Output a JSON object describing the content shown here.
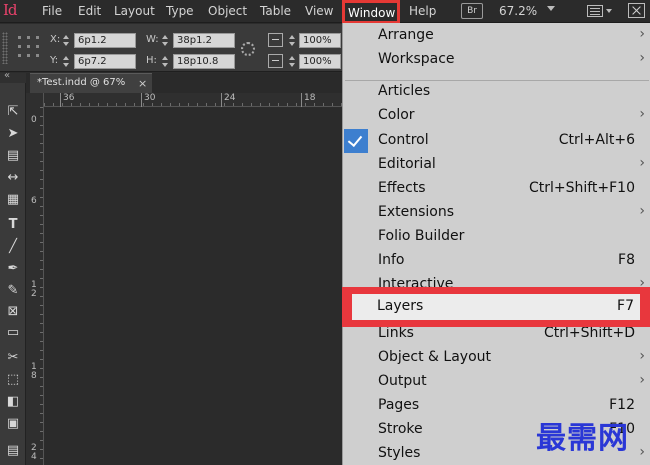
{
  "app": {
    "logo": "Id"
  },
  "menubar": {
    "items": [
      "File",
      "Edit",
      "Layout",
      "Type",
      "Object",
      "Table",
      "View",
      "Window",
      "Help"
    ],
    "bridge_badge": "Br",
    "zoom": "67.2%"
  },
  "control_bar": {
    "x_label": "X:",
    "x_value": "6p1.2",
    "y_label": "Y:",
    "y_value": "6p7.2",
    "w_label": "W:",
    "w_value": "38p1.2",
    "h_label": "H:",
    "h_value": "18p10.8",
    "scale_x": "100%",
    "scale_y": "100%"
  },
  "document_tab": {
    "title": "*Test.indd @ 67%",
    "close": "×"
  },
  "rulers": {
    "horizontal": [
      "36",
      "30",
      "24",
      "18"
    ],
    "vertical": [
      "0",
      "6",
      "1\n2",
      "1\n8",
      "2\n4"
    ]
  },
  "window_menu": {
    "items": [
      {
        "label": "Arrange",
        "shortcut": "",
        "submenu": true
      },
      {
        "label": "Workspace",
        "shortcut": "",
        "submenu": true
      },
      {
        "label": "Articles",
        "shortcut": "",
        "submenu": false
      },
      {
        "label": "Color",
        "shortcut": "",
        "submenu": true
      },
      {
        "label": "Control",
        "shortcut": "Ctrl+Alt+6",
        "submenu": false,
        "checked": true
      },
      {
        "label": "Editorial",
        "shortcut": "",
        "submenu": true
      },
      {
        "label": "Effects",
        "shortcut": "Ctrl+Shift+F10",
        "submenu": false
      },
      {
        "label": "Extensions",
        "shortcut": "",
        "submenu": true
      },
      {
        "label": "Folio Builder",
        "shortcut": "",
        "submenu": false
      },
      {
        "label": "Info",
        "shortcut": "F8",
        "submenu": false
      },
      {
        "label": "Interactive",
        "shortcut": "",
        "submenu": true
      },
      {
        "label": "Layers",
        "shortcut": "F7",
        "submenu": false,
        "highlighted": true
      },
      {
        "label": "Links",
        "shortcut": "Ctrl+Shift+D",
        "submenu": false
      },
      {
        "label": "Object & Layout",
        "shortcut": "",
        "submenu": true
      },
      {
        "label": "Output",
        "shortcut": "",
        "submenu": true
      },
      {
        "label": "Pages",
        "shortcut": "F12",
        "submenu": false
      },
      {
        "label": "Stroke",
        "shortcut": "F10",
        "submenu": false
      },
      {
        "label": "Styles",
        "shortcut": "",
        "submenu": true
      }
    ],
    "submenu_glyph": "›",
    "highlight_color": "#e8373d"
  },
  "watermark": "最需网"
}
